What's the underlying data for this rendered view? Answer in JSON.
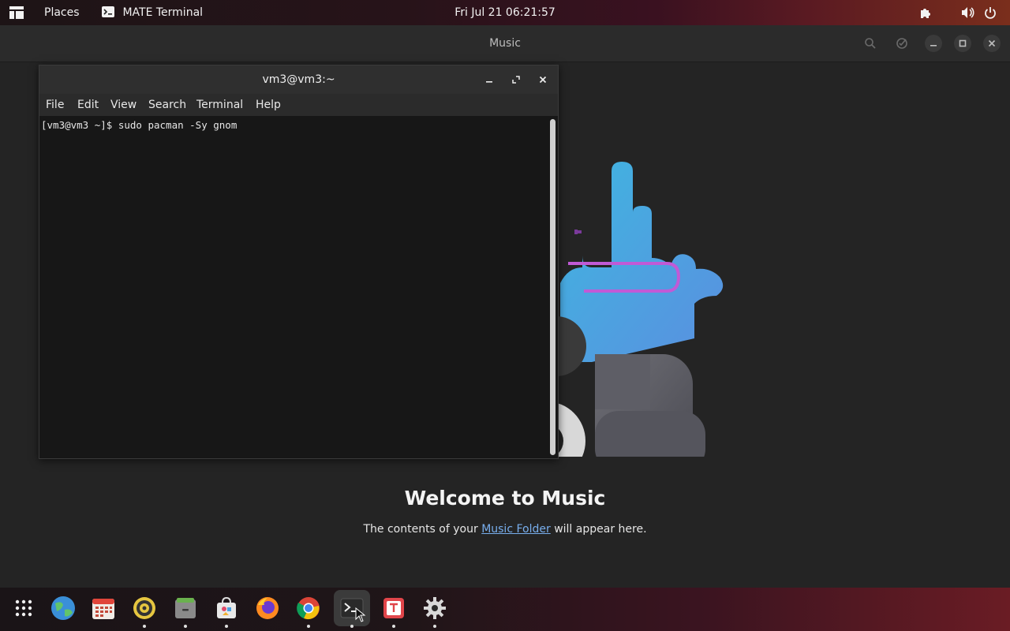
{
  "top_panel": {
    "places_label": "Places",
    "app_label": "MATE Terminal",
    "clock": "Fri Jul 21  06:21:57"
  },
  "music": {
    "title": "Music",
    "welcome_title": "Welcome to Music",
    "welcome_prefix": "The contents of your ",
    "welcome_link": "Music Folder",
    "welcome_suffix": " will appear here."
  },
  "terminal": {
    "title": "vm3@vm3:~",
    "menu": [
      "File",
      "Edit",
      "View",
      "Search",
      "Terminal",
      "Help"
    ],
    "line": "[vm3@vm3 ~]$ sudo pacman -Sy gnom"
  },
  "dock": {
    "items": [
      "app-grid",
      "web-browser",
      "calendar",
      "rhythmbox",
      "files",
      "software",
      "firefox",
      "chrome",
      "terminal",
      "text-editor",
      "settings"
    ]
  },
  "colors": {
    "accent_link": "#78aeed",
    "panel_end": "#7a2e1c"
  }
}
